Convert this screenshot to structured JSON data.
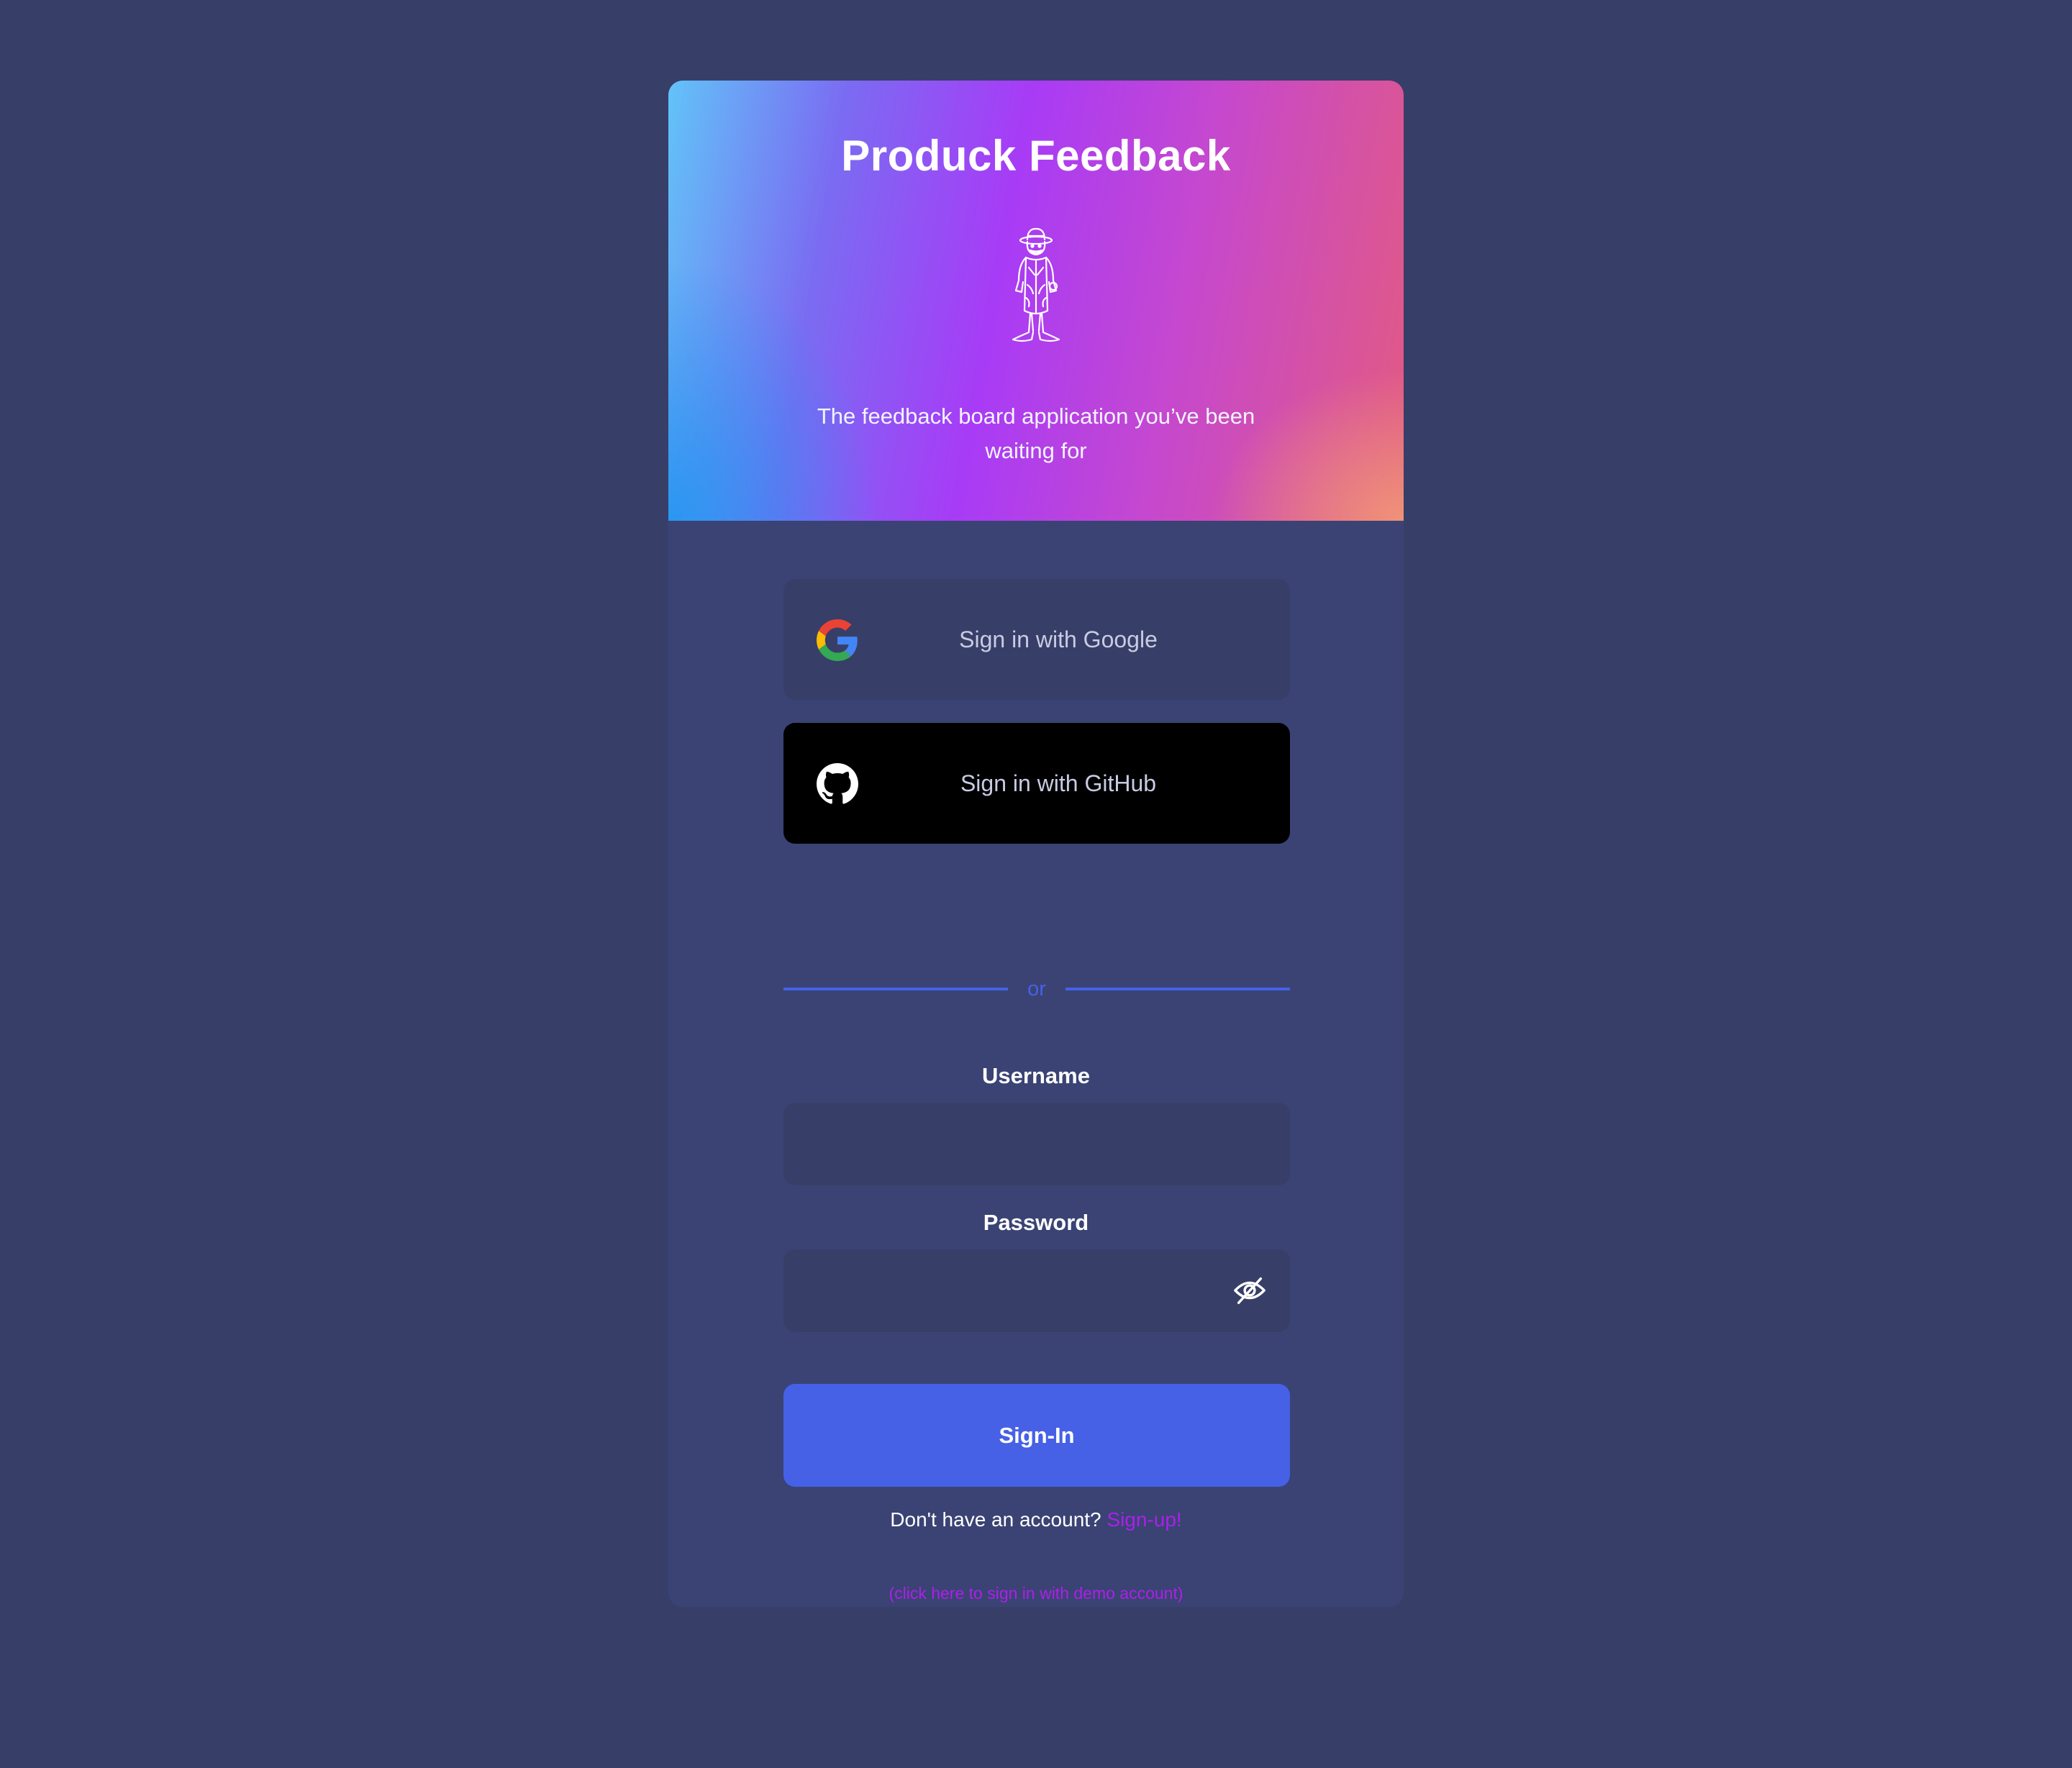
{
  "hero": {
    "title": "Produck Feedback",
    "tagline": "The feedback board application you’ve been waiting for",
    "mascot_icon": "duck-detective-icon"
  },
  "social_auth": {
    "google": {
      "label": "Sign in with Google",
      "icon": "google-icon"
    },
    "github": {
      "label": "Sign in with GitHub",
      "icon": "github-icon"
    }
  },
  "divider": {
    "text": "or"
  },
  "form": {
    "username": {
      "label": "Username",
      "value": "",
      "placeholder": ""
    },
    "password": {
      "label": "Password",
      "value": "",
      "placeholder": "",
      "toggle_icon": "eye-off-icon"
    },
    "submit_label": "Sign-In"
  },
  "footer": {
    "account_prompt": "Don't have an account?",
    "signup_label": "Sign-up!",
    "demo_label": "(click here to sign in with demo account)"
  },
  "colors": {
    "background": "#373f68",
    "card": "#3a4374",
    "accent_blue": "#4661e6",
    "accent_purple": "#ad1fea"
  }
}
